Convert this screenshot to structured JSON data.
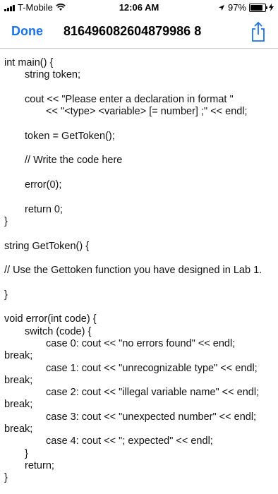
{
  "status_bar": {
    "carrier": "T-Mobile",
    "time": "12:06 AM",
    "battery_percent": "97%",
    "battery_level": 0.97,
    "icons": [
      "signal-icon",
      "wifi-icon",
      "location-arrow-icon",
      "battery-icon",
      "charging-bolt-icon"
    ]
  },
  "nav": {
    "done_label": "Done",
    "title": "816496082604879986 8",
    "share_icon": "share-icon",
    "accent_color": "#1a73e8"
  },
  "code_lines": [
    {
      "text": "int main() {",
      "indent": 0
    },
    {
      "text": "string token;",
      "indent": 1
    },
    {
      "text": "",
      "indent": 0
    },
    {
      "text": "cout << \"Please enter a declaration in format \"",
      "indent": 1
    },
    {
      "text": "<< \"<type> <variable> [= number] ;\" << endl;",
      "indent": 2
    },
    {
      "text": "",
      "indent": 0
    },
    {
      "text": "token = GetToken();",
      "indent": 1
    },
    {
      "text": "",
      "indent": 0
    },
    {
      "text": "// Write the code here",
      "indent": 1
    },
    {
      "text": "",
      "indent": 0
    },
    {
      "text": "error(0);",
      "indent": 1
    },
    {
      "text": "",
      "indent": 0
    },
    {
      "text": "return 0;",
      "indent": 1
    },
    {
      "text": "}",
      "indent": 0
    },
    {
      "text": "",
      "indent": 0
    },
    {
      "text": "string GetToken() {",
      "indent": 0
    },
    {
      "text": "",
      "indent": 0
    },
    {
      "text": "// Use the Gettoken function you have designed in Lab 1.",
      "indent": 0
    },
    {
      "text": "",
      "indent": 0
    },
    {
      "text": "}",
      "indent": 0
    },
    {
      "text": "",
      "indent": 0
    },
    {
      "text": "void error(int code) {",
      "indent": 0
    },
    {
      "text": "switch (code) {",
      "indent": 1
    },
    {
      "text": "case 0: cout << \"no errors found\" << endl;",
      "indent": 2
    },
    {
      "text": "break;",
      "indent": 0
    },
    {
      "text": "case 1: cout << \"unrecognizable type\" << endl;",
      "indent": 2
    },
    {
      "text": "break;",
      "indent": 0
    },
    {
      "text": "case 2: cout << \"illegal variable name\" << endl;",
      "indent": 2
    },
    {
      "text": "break;",
      "indent": 0
    },
    {
      "text": "case 3: cout << \"unexpected number\" << endl;",
      "indent": 2
    },
    {
      "text": "break;",
      "indent": 0
    },
    {
      "text": "case 4: cout << \"; expected\" << endl;",
      "indent": 2
    },
    {
      "text": "}",
      "indent": 1
    },
    {
      "text": "return;",
      "indent": 1
    },
    {
      "text": "}",
      "indent": 0
    }
  ]
}
